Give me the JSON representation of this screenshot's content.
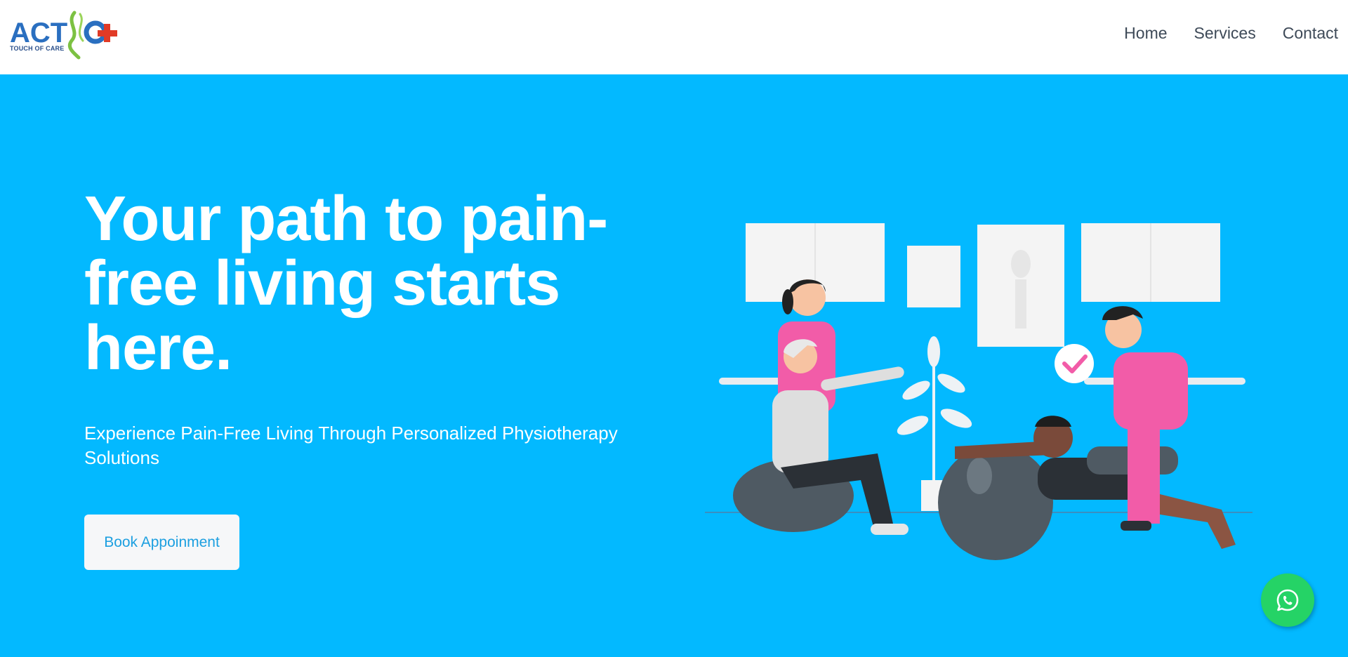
{
  "brand": {
    "logo_text": "ACT",
    "logo_sub": "TOUCH OF CARE",
    "logo_colors": {
      "blue": "#2a6fc0",
      "green": "#7cc142",
      "red": "#e13a26"
    }
  },
  "nav": {
    "items": [
      {
        "label": "Home"
      },
      {
        "label": "Services"
      },
      {
        "label": "Contact"
      }
    ]
  },
  "hero": {
    "headline": "Your path to pain-free living starts here.",
    "subtitle": "Experience Pain-Free Living Through Personalized Physiotherapy Solutions",
    "cta_label": "Book Appoinment",
    "background_color": "#03b9ff"
  },
  "illustration": {
    "subject": "physiotherapy-clinic-illustration",
    "accent_color": "#f25ca8"
  },
  "floating": {
    "icon": "whatsapp-icon",
    "color": "#25d366"
  }
}
